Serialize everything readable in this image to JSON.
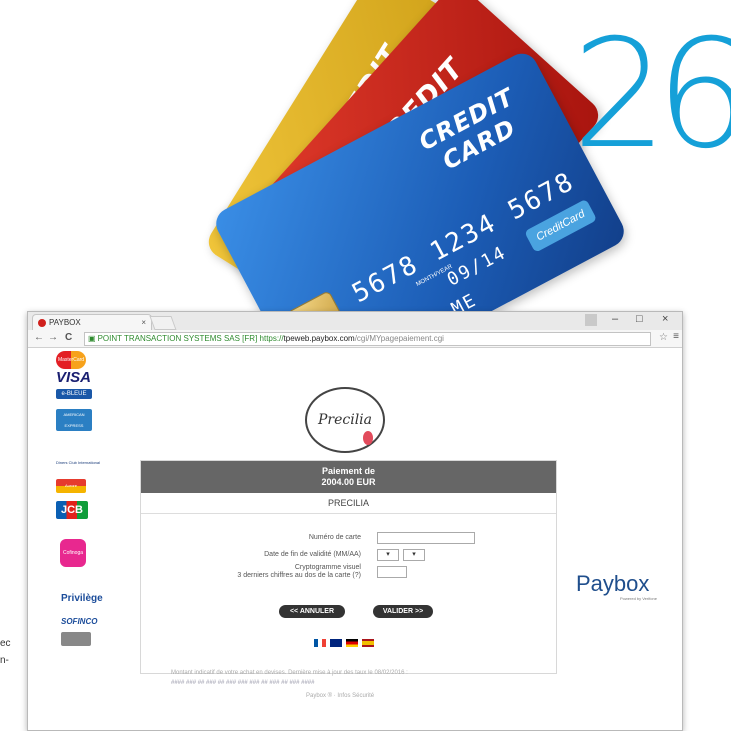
{
  "hero": {
    "card_yellow_text": "CREDIT",
    "card_red_text": "CREDIT",
    "card_blue_text_1": "CREDIT",
    "card_blue_text_2": "CARD",
    "card_number": "5678 1234 5678",
    "card_valid_label": "MONTH/YEAR",
    "card_expiry": "09/14",
    "card_name_partial": "ME",
    "card_brand": "CreditCard",
    "number_26": "26"
  },
  "browser": {
    "tab_title": "PAYBOX",
    "tab_close": "×",
    "window_controls": [
      "–",
      "□",
      "×"
    ],
    "nav_back": "←",
    "nav_forward": "→",
    "nav_reload": "C",
    "url_cert": "POINT TRANSACTION SYSTEMS SAS [FR]",
    "url_scheme": "https://",
    "url_host": "tpeweb.paybox.com",
    "url_path": "/cgi/MYpagepaiement.cgi",
    "bookmark_icon": "☆",
    "menu_icon": "≡"
  },
  "page": {
    "left_logos": [
      "MasterCard",
      "VISA",
      "e-BLEUE",
      "AMERICAN EXPRESS",
      "Diners Club International",
      "Aurore",
      "JCB",
      "Cofinoga",
      "Privilège",
      "SOFINCO"
    ],
    "merchant_logo": "Precilia",
    "payment_title": "Paiement de",
    "payment_amount": "2004.00 EUR",
    "merchant_name": "PRECILIA",
    "label_card_number": "Numéro de carte",
    "label_expiry": "Date de fin de validité (MM/AA)",
    "label_cvv_1": "Cryptogramme visuel",
    "label_cvv_2": "3 derniers chiffres au dos de la carte (?)",
    "select_month": "▾",
    "select_year": "▾",
    "button_cancel": "<< ANNULER",
    "button_validate": "VALIDER >>",
    "flags": [
      "fr",
      "uk",
      "de",
      "es"
    ],
    "footer_text": "Montant indicatif de votre achat en devises. Dernière mise à jour des taux le 08/02/2016 :",
    "footer_currencies": "#### ### ## ### ## ### ### ### ## ### ## ### ####",
    "footer_links": "Paybox ® · Infos Sécurité",
    "paybox_brand": "Paybox",
    "paybox_sub": "Powered by Verifone"
  },
  "sidebar_fragments": [
    "ec",
    "n-"
  ]
}
